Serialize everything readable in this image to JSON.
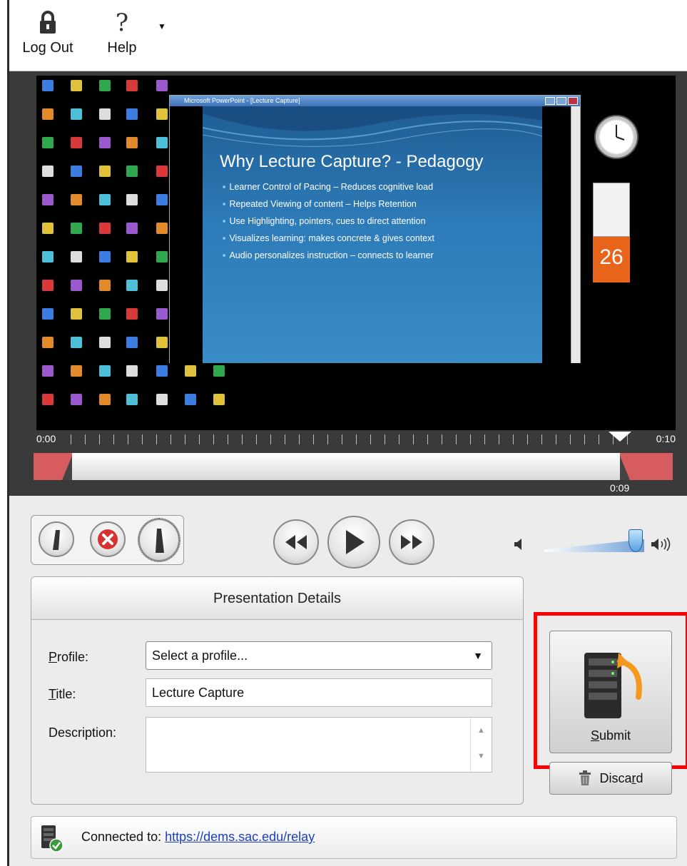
{
  "toolbar": {
    "logout_label": "Log Out",
    "logout_icon": "lock-icon",
    "help_label": "Help",
    "help_icon": "question-icon",
    "dropdown_icon": "chevron-down-icon"
  },
  "video": {
    "window_title": "Microsoft PowerPoint - [Lecture Capture]",
    "slide_title": "Why Lecture Capture? - Pedagogy",
    "slide_bullets": [
      "Learner Control of Pacing – Reduces cognitive load",
      "Repeated Viewing of content – Helps Retention",
      "Use Highlighting, pointers, cues to direct attention",
      "Visualizes learning: makes concrete & gives context",
      "Audio personalizes instruction – connects to learner"
    ],
    "calendar_day": "26"
  },
  "timeline": {
    "start_time": "0:00",
    "end_time": "0:10",
    "current_time": "0:09"
  },
  "controls": {
    "trim_start_icon": "trim-start-icon",
    "delete_icon": "delete-x-icon",
    "trim_end_icon": "trim-end-icon",
    "rewind_icon": "rewind-icon",
    "play_icon": "play-icon",
    "fast_forward_icon": "fast-forward-icon",
    "volume_level": 0.85
  },
  "details": {
    "header": "Presentation Details",
    "profile_label_accel": "P",
    "profile_label_rest": "rofile:",
    "profile_value": "Select a profile...",
    "title_label_accel": "T",
    "title_label_rest": "itle:",
    "title_value": "Lecture Capture",
    "description_label": "Description:",
    "description_value": ""
  },
  "actions": {
    "submit_accel": "S",
    "submit_rest": "ubmit",
    "discard_pre": "Disca",
    "discard_accel": "r",
    "discard_post": "d"
  },
  "status": {
    "prefix": "Connected to: ",
    "url": "https://dems.sac.edu/relay"
  },
  "colors": {
    "highlight": "#ff0000",
    "trim_region": "#d65c60",
    "link": "#1a3fbf",
    "calendar": "#e8641b"
  }
}
